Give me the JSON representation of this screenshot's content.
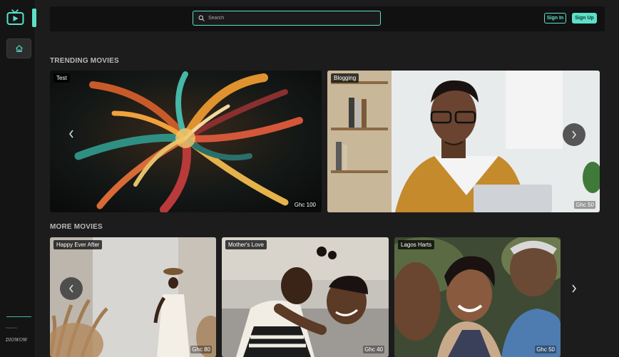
{
  "header": {
    "search_placeholder": "Search",
    "sign_in_label": "Sign In",
    "sign_up_label": "Sign Up"
  },
  "sidebar": {
    "nav": [
      {
        "icon": "home-icon"
      }
    ],
    "powered_by": "Powered by",
    "brand_mark": "DIOWOW"
  },
  "trending": {
    "title": "TRENDING MOVIES",
    "movies": [
      {
        "title": "Test",
        "price": "Ghc 100"
      },
      {
        "title": "Blogging",
        "price": "Ghc 50"
      }
    ]
  },
  "more": {
    "title": "MORE MOVIES",
    "movies": [
      {
        "title": "Happy Ever After",
        "price": "Ghc 80"
      },
      {
        "title": "Mother's Love",
        "price": "Ghc 40"
      },
      {
        "title": "Lagos Harts",
        "price": "Ghc 50"
      }
    ]
  },
  "colors": {
    "accent": "#5ce0c8",
    "background": "#1c1c1c",
    "sidebar": "#141414"
  }
}
